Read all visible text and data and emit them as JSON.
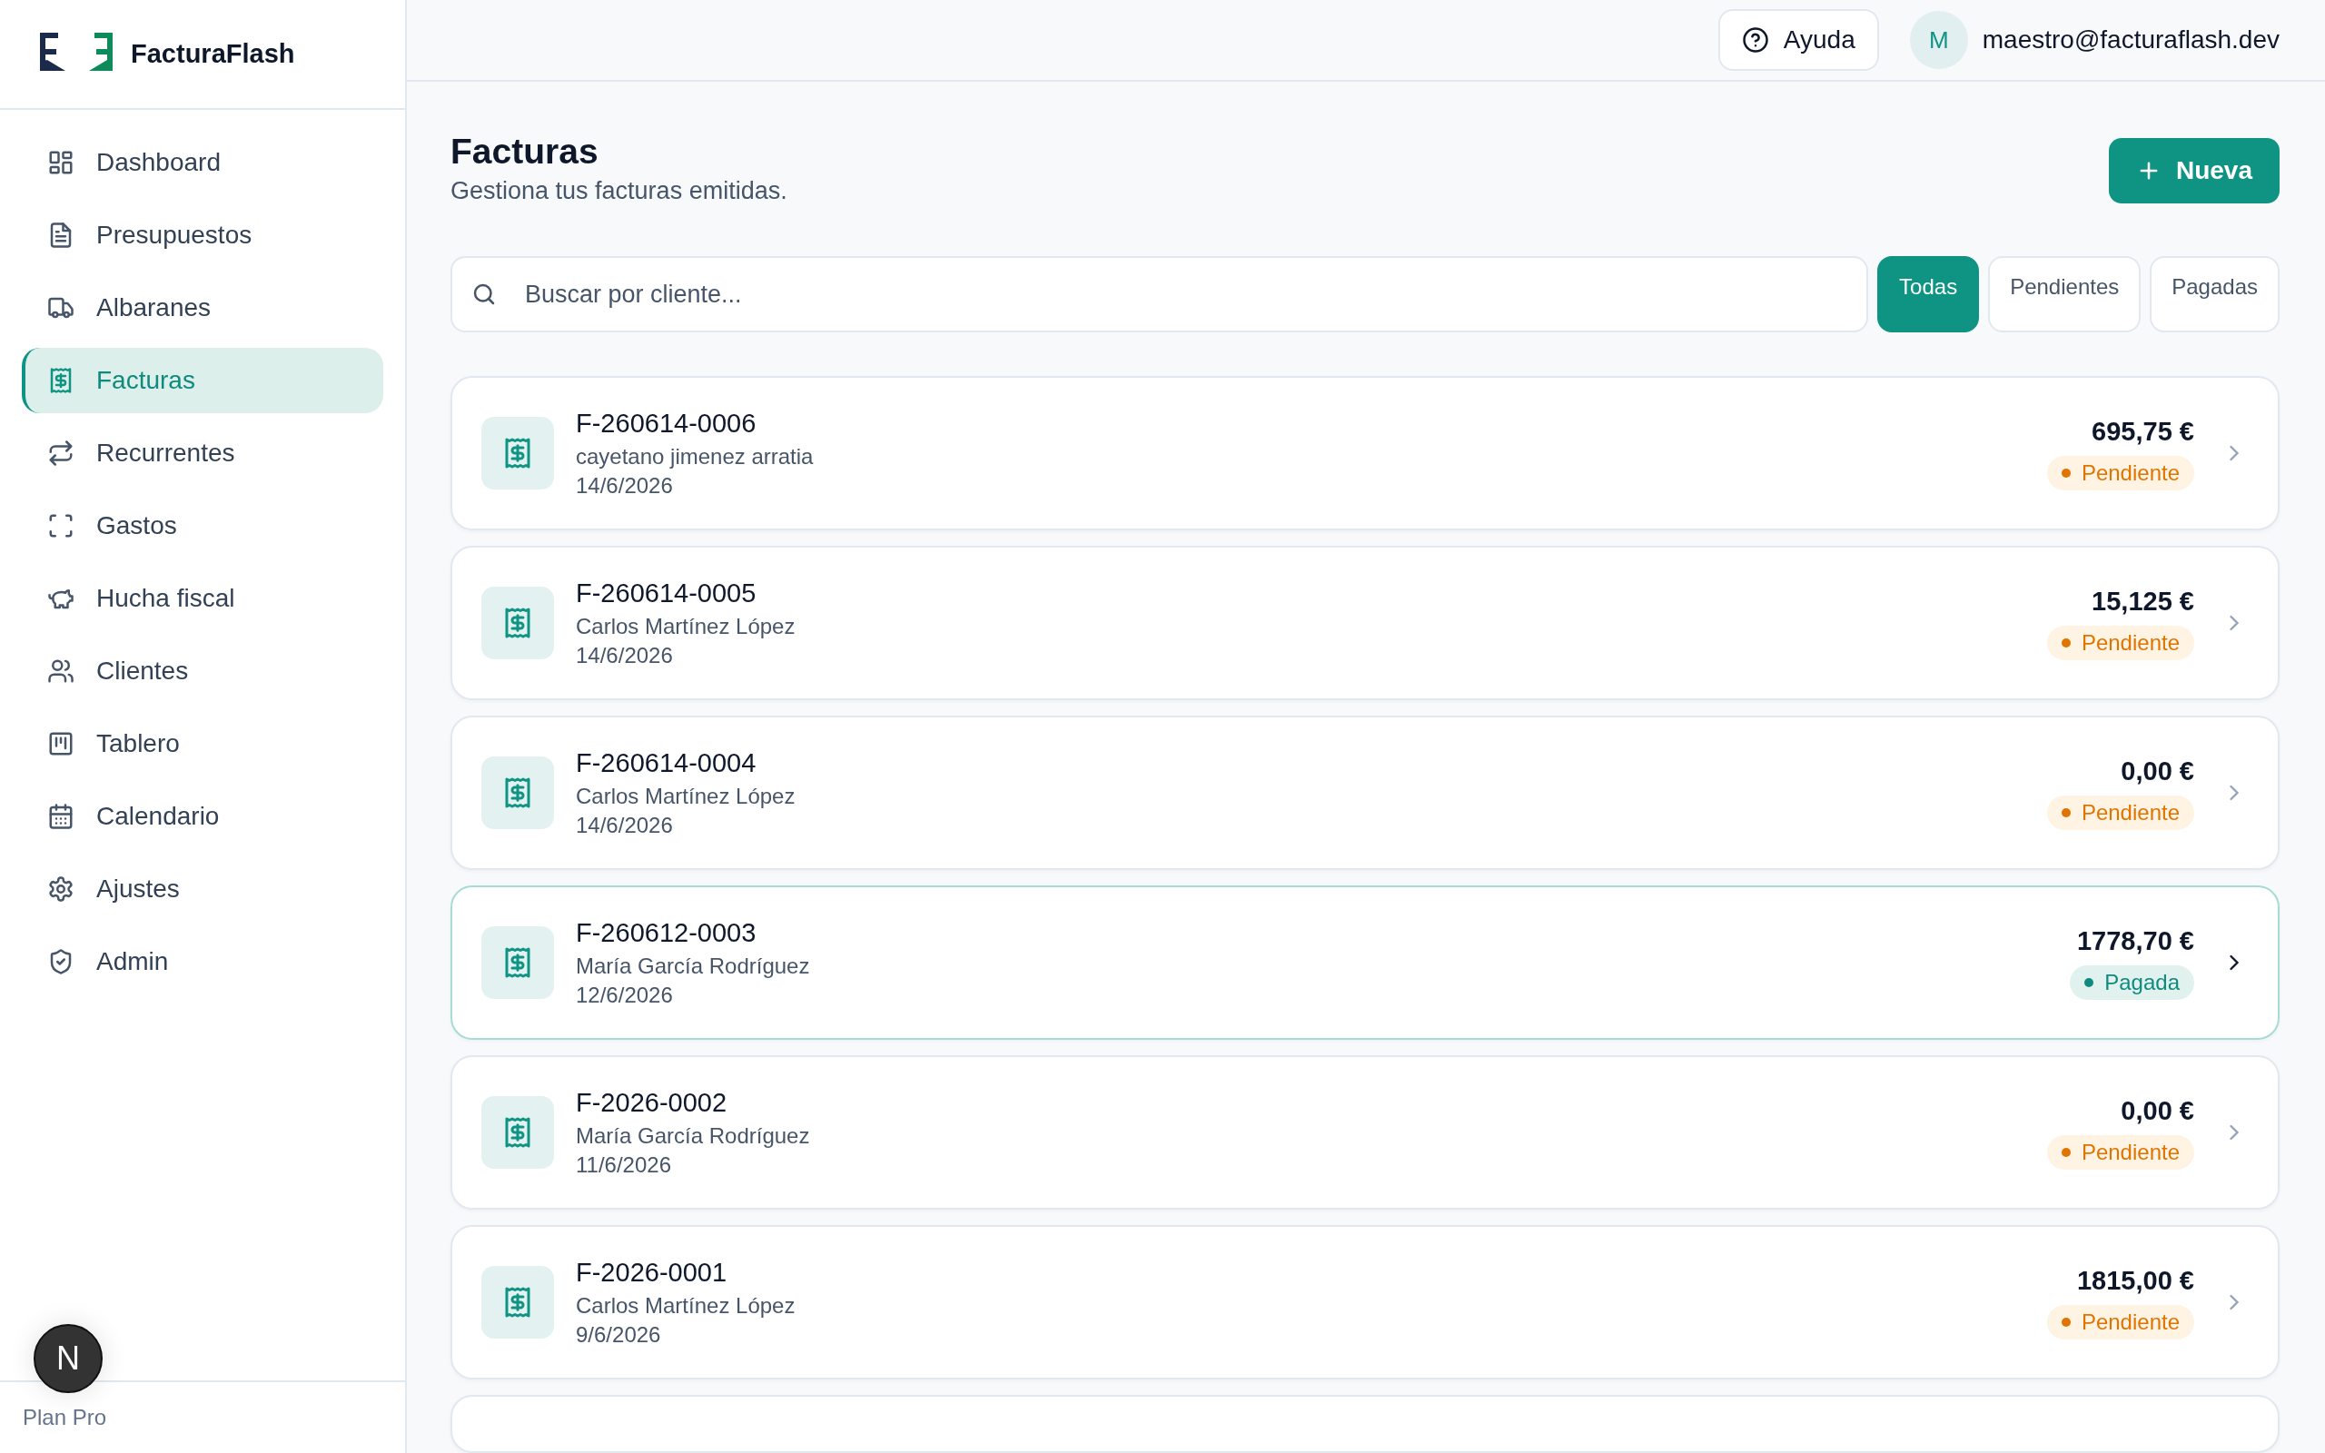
{
  "brand": {
    "name": "FacturaFlash"
  },
  "sidebar": {
    "items": [
      {
        "label": "Dashboard",
        "selected": false
      },
      {
        "label": "Presupuestos",
        "selected": false
      },
      {
        "label": "Albaranes",
        "selected": false
      },
      {
        "label": "Facturas",
        "selected": true
      },
      {
        "label": "Recurrentes",
        "selected": false
      },
      {
        "label": "Gastos",
        "selected": false
      },
      {
        "label": "Hucha fiscal",
        "selected": false
      },
      {
        "label": "Clientes",
        "selected": false
      },
      {
        "label": "Tablero",
        "selected": false
      },
      {
        "label": "Calendario",
        "selected": false
      },
      {
        "label": "Ajustes",
        "selected": false
      },
      {
        "label": "Admin",
        "selected": false
      }
    ],
    "plan": "Plan Pro"
  },
  "dev_badge": "N",
  "header": {
    "help": "Ayuda",
    "avatar": "M",
    "email": "maestro@facturaflash.dev"
  },
  "page": {
    "title": "Facturas",
    "subtitle": "Gestiona tus facturas emitidas.",
    "new_button": "Nueva"
  },
  "search": {
    "placeholder": "Buscar por cliente..."
  },
  "filters": [
    {
      "label": "Todas",
      "selected": true
    },
    {
      "label": "Pendientes",
      "selected": false
    },
    {
      "label": "Pagadas",
      "selected": false
    }
  ],
  "invoices": [
    {
      "number": "F-260614-0006",
      "client": "cayetano jimenez arratia",
      "date": "14/6/2026",
      "amount": "695,75 €",
      "status": "Pendiente",
      "kind": "pending",
      "hovered": false
    },
    {
      "number": "F-260614-0005",
      "client": "Carlos Martínez López",
      "date": "14/6/2026",
      "amount": "15,125 €",
      "status": "Pendiente",
      "kind": "pending",
      "hovered": false
    },
    {
      "number": "F-260614-0004",
      "client": "Carlos Martínez López",
      "date": "14/6/2026",
      "amount": "0,00 €",
      "status": "Pendiente",
      "kind": "pending",
      "hovered": false
    },
    {
      "number": "F-260612-0003",
      "client": "María García Rodríguez",
      "date": "12/6/2026",
      "amount": "1778,70 €",
      "status": "Pagada",
      "kind": "paid",
      "hovered": true
    },
    {
      "number": "F-2026-0002",
      "client": "María García Rodríguez",
      "date": "11/6/2026",
      "amount": "0,00 €",
      "status": "Pendiente",
      "kind": "pending",
      "hovered": false
    },
    {
      "number": "F-2026-0001",
      "client": "Carlos Martínez López",
      "date": "9/6/2026",
      "amount": "1815,00 €",
      "status": "Pendiente",
      "kind": "pending",
      "hovered": false
    }
  ]
}
